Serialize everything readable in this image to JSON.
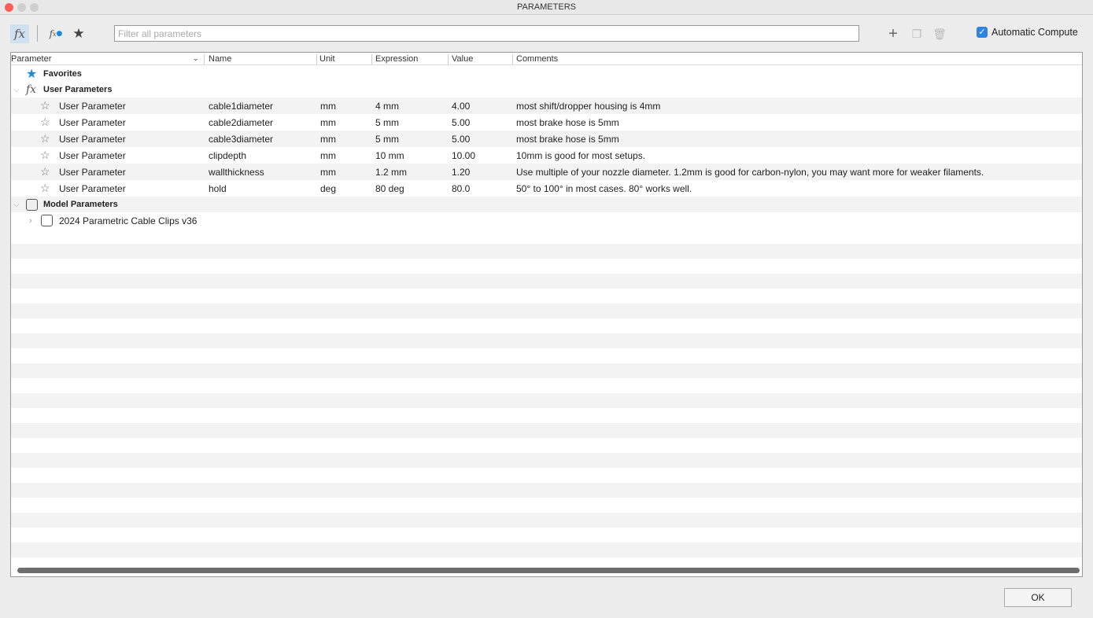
{
  "window": {
    "title": "PARAMETERS"
  },
  "toolbar": {
    "filter_placeholder": "Filter all parameters",
    "auto_compute_label": "Automatic Compute",
    "auto_compute_checked": true,
    "fx_label": "fx"
  },
  "columns": [
    "Parameter",
    "Name",
    "Unit",
    "Expression",
    "Value",
    "Comments"
  ],
  "groups": {
    "favorites": "Favorites",
    "user": "User Parameters",
    "model": "Model Parameters",
    "model_child": "2024 Parametric Cable Clips v36"
  },
  "rows": [
    {
      "type": "User Parameter",
      "name": "cable1diameter",
      "unit": "mm",
      "expression": "4 mm",
      "value": "4.00",
      "comment": "most shift/dropper housing is 4mm"
    },
    {
      "type": "User Parameter",
      "name": "cable2diameter",
      "unit": "mm",
      "expression": "5 mm",
      "value": "5.00",
      "comment": "most brake hose is 5mm"
    },
    {
      "type": "User Parameter",
      "name": "cable3diameter",
      "unit": "mm",
      "expression": "5 mm",
      "value": "5.00",
      "comment": "most brake hose is 5mm"
    },
    {
      "type": "User Parameter",
      "name": "clipdepth",
      "unit": "mm",
      "expression": "10 mm",
      "value": "10.00",
      "comment": "10mm is good for most setups."
    },
    {
      "type": "User Parameter",
      "name": "wallthickness",
      "unit": "mm",
      "expression": "1.2 mm",
      "value": "1.20",
      "comment": "Use multiple of your nozzle diameter. 1.2mm is good for carbon-nylon, you may want more for weaker filaments."
    },
    {
      "type": "User Parameter",
      "name": "hold",
      "unit": "deg",
      "expression": "80 deg",
      "value": "80.0",
      "comment": "50° to 100° in most cases. 80° works well."
    }
  ],
  "footer": {
    "ok_label": "OK"
  }
}
